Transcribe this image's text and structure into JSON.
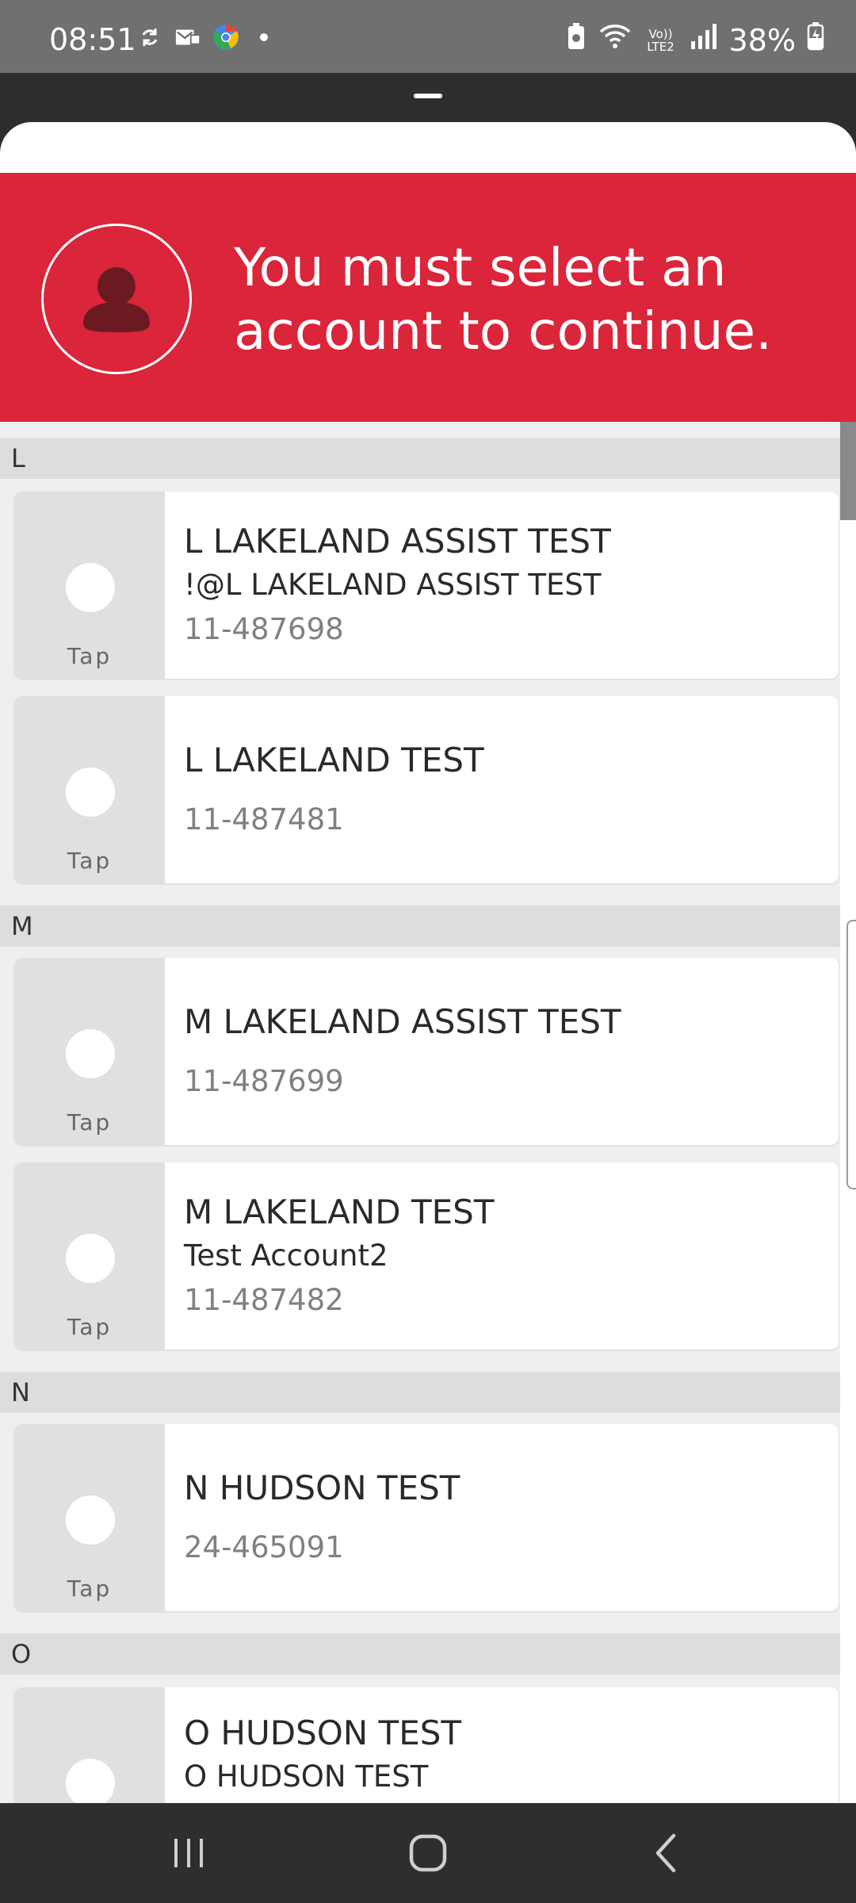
{
  "status": {
    "time": "08:51",
    "network": "Vo)) LTE2",
    "battery": "38%",
    "icons": [
      "sync-icon",
      "mail-icon",
      "chrome-icon",
      "dot-icon",
      "battery-saver-icon",
      "wifi-icon",
      "signal-icon",
      "battery-icon"
    ]
  },
  "banner": {
    "message": "You must select an account to continue.",
    "color": "#da253a"
  },
  "tap_label": "Tap",
  "sections": [
    {
      "letter": "L",
      "accounts": [
        {
          "name": "L LAKELAND ASSIST TEST",
          "alias": "!@L LAKELAND ASSIST TEST",
          "number": "11-487698"
        },
        {
          "name": "L LAKELAND TEST",
          "alias": "",
          "number": "11-487481"
        }
      ]
    },
    {
      "letter": "M",
      "accounts": [
        {
          "name": "M LAKELAND ASSIST TEST",
          "alias": "",
          "number": "11-487699"
        },
        {
          "name": "M LAKELAND TEST",
          "alias": "Test Account2",
          "number": "11-487482"
        }
      ]
    },
    {
      "letter": "N",
      "accounts": [
        {
          "name": "N HUDSON TEST",
          "alias": "",
          "number": "24-465091"
        }
      ]
    },
    {
      "letter": "O",
      "accounts": [
        {
          "name": "O HUDSON TEST",
          "alias": "O HUDSON TEST",
          "number": ""
        }
      ]
    }
  ],
  "nav": [
    "recent-apps-icon",
    "home-icon",
    "back-icon"
  ]
}
